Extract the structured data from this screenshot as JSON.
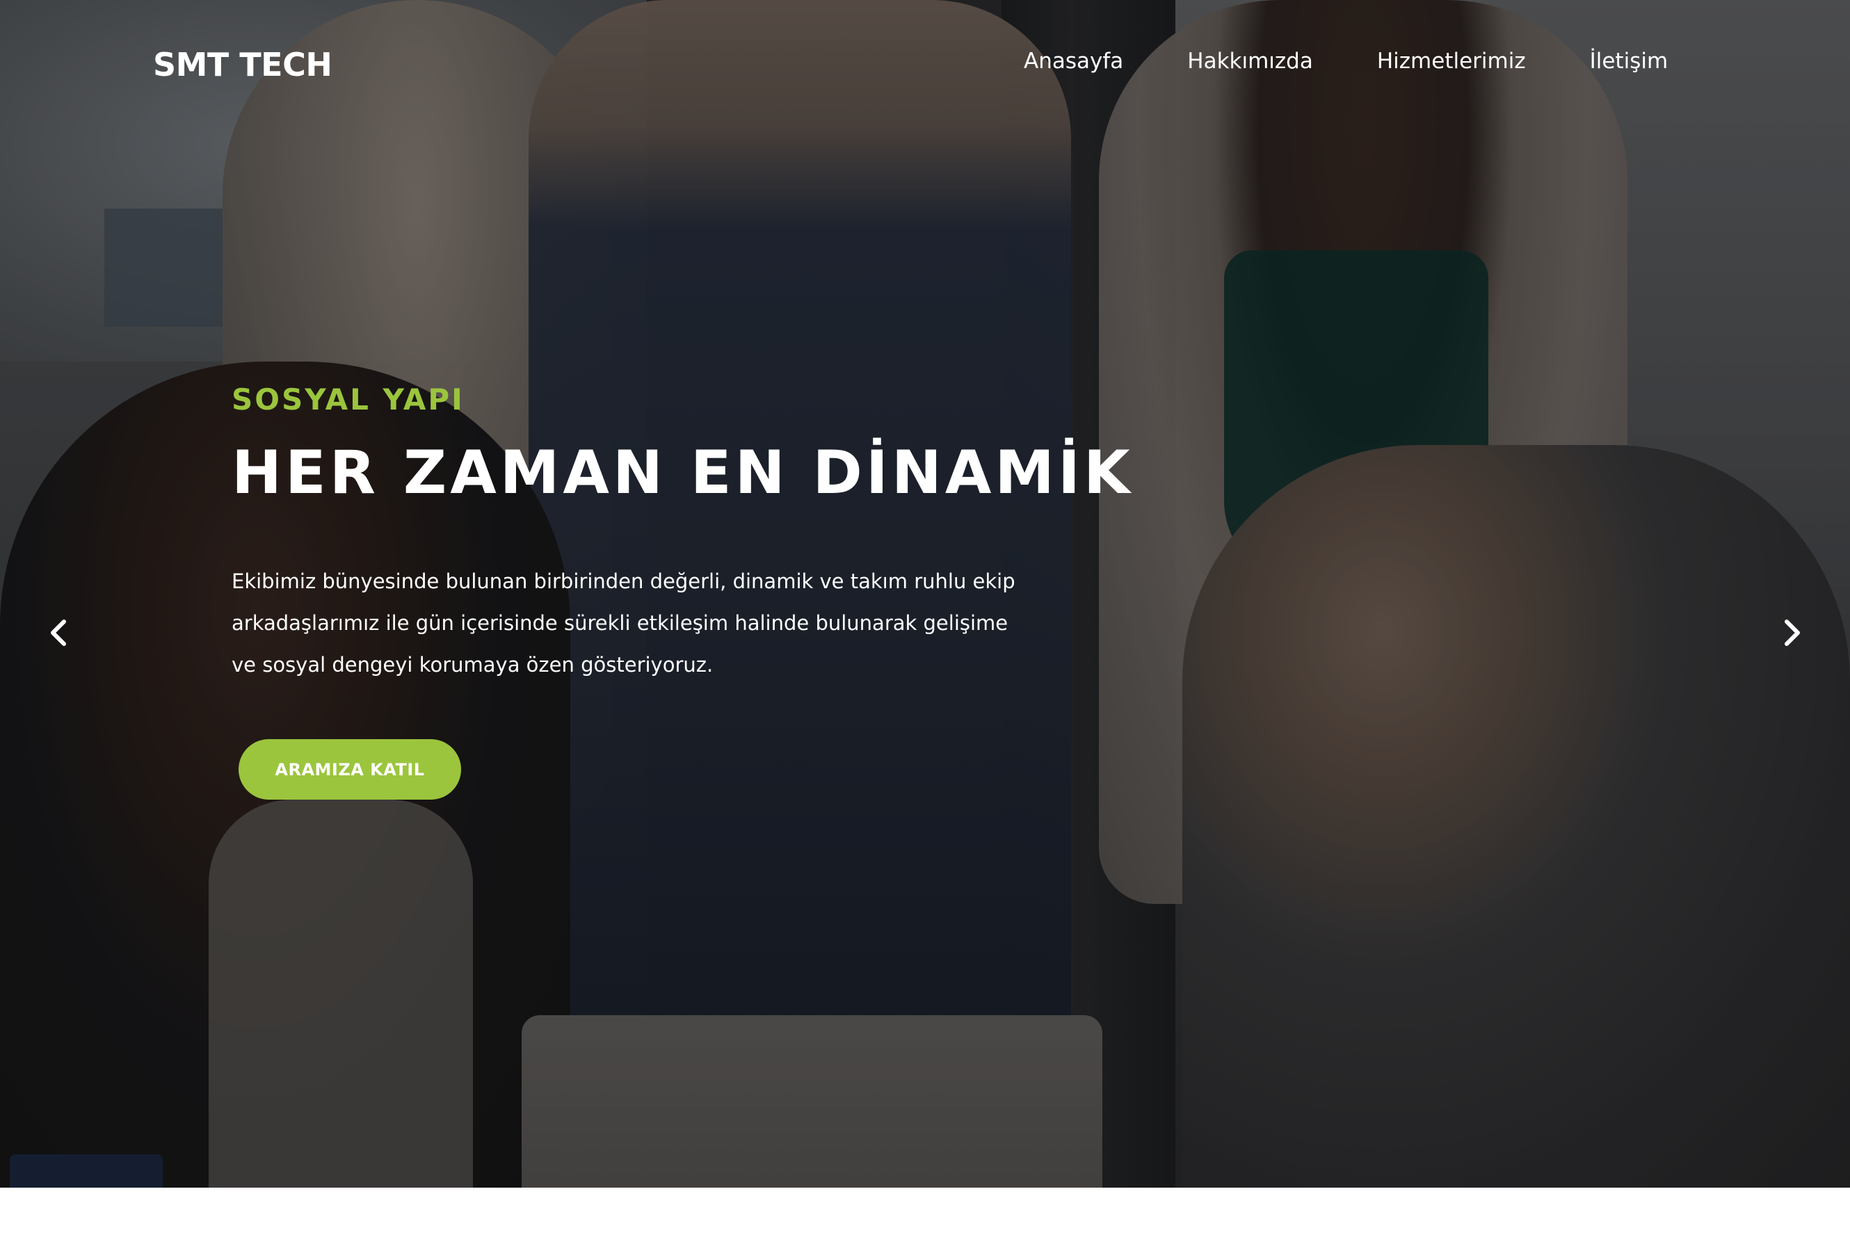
{
  "brand": {
    "name": "SMT TECH"
  },
  "nav": {
    "items": [
      {
        "label": "Anasayfa"
      },
      {
        "label": "Hakkımızda"
      },
      {
        "label": "Hizmetlerimiz"
      },
      {
        "label": "İletişim"
      }
    ]
  },
  "hero": {
    "eyebrow": "SOSYAL YAPI",
    "headline": "HER ZAMAN EN DİNAMİK",
    "lead": "Ekibimiz bünyesinde bulunan birbirinden değerli, dinamik ve takım ruhlu ekip arkadaşlarımız ile gün içerisinde sürekli etkileşim halinde bulunarak gelişime ve sosyal dengeyi korumaya özen gösteriyoruz.",
    "cta_label": "ARAMIZA KATIL"
  },
  "carousel": {
    "prev_icon": "chevron-left-icon",
    "next_icon": "chevron-right-icon"
  },
  "colors": {
    "accent": "#9bc53d",
    "text": "#ffffff",
    "page_background": "#ffffff"
  }
}
